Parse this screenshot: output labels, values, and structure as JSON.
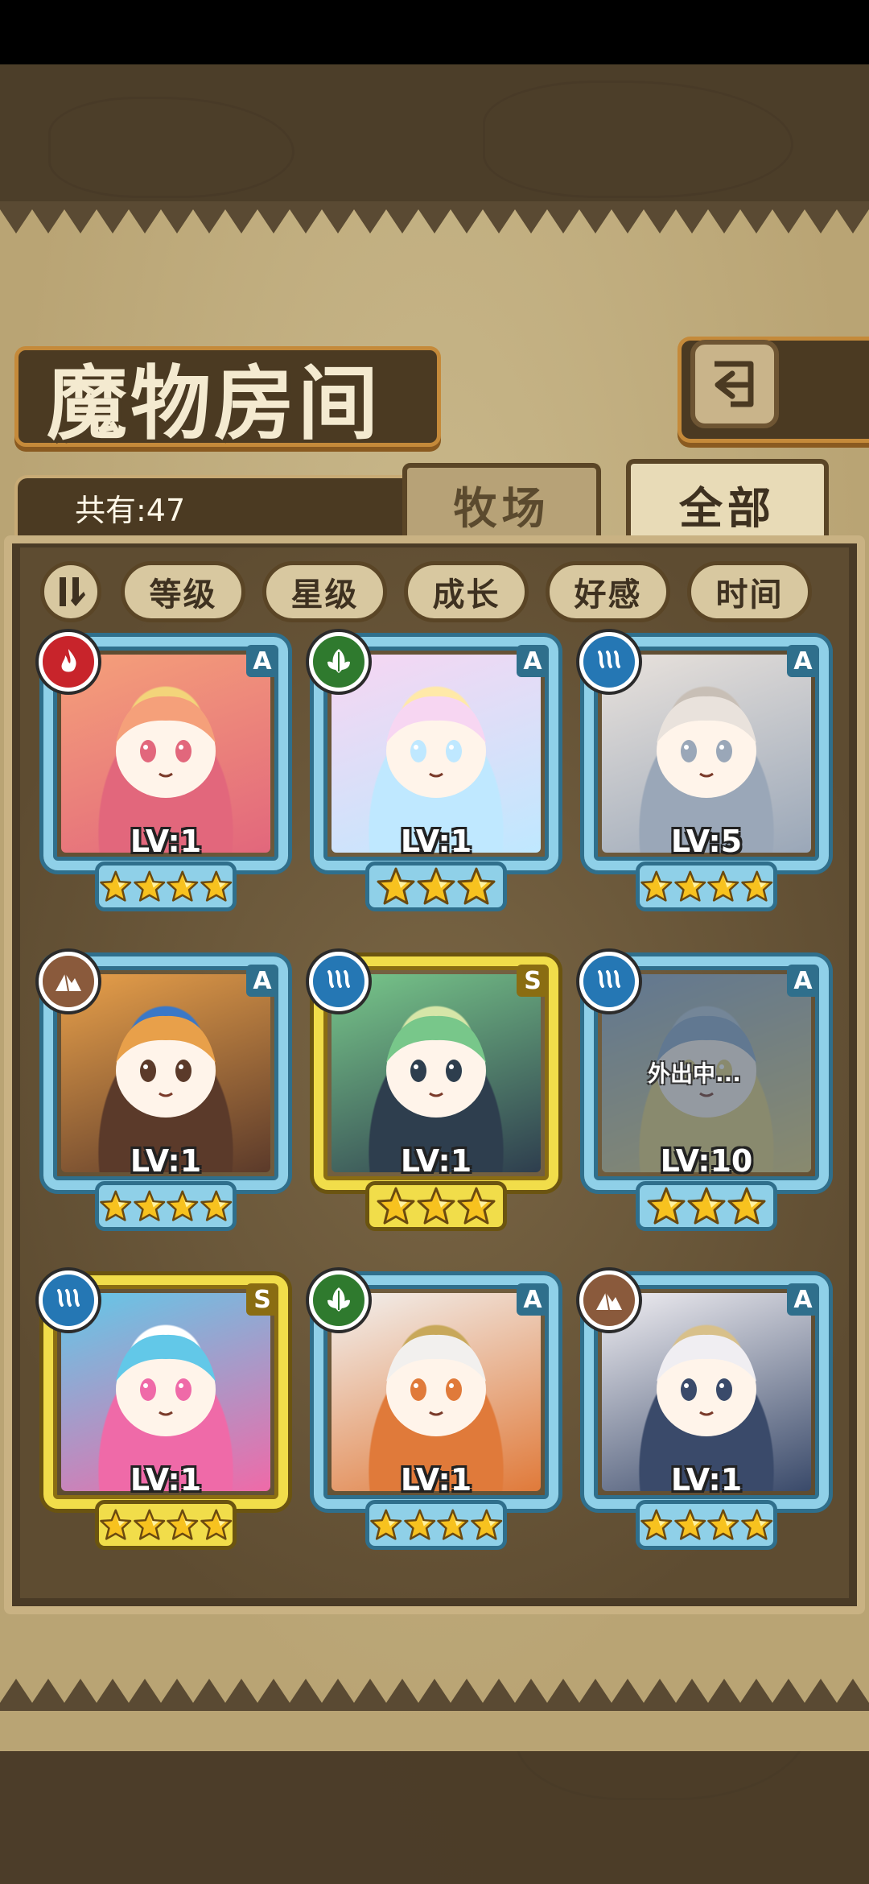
{
  "title": "魔物房间",
  "count_label": "共有:47",
  "tabs": {
    "ranch": "牧场",
    "all": "全部"
  },
  "sort_buttons": [
    "等级",
    "星级",
    "成长",
    "好感",
    "时间"
  ],
  "monsters": [
    {
      "element": "fire-icon",
      "element_color": "#c8242b",
      "rank": "A",
      "level": "LV:1",
      "stars": 4,
      "frame": "blue",
      "palette": [
        "#f5a07a",
        "#e2677c",
        "#f3d47a"
      ]
    },
    {
      "element": "leaf-icon",
      "element_color": "#2f7a2e",
      "rank": "A",
      "level": "LV:1",
      "stars": 3,
      "frame": "blue",
      "palette": [
        "#f7d6f2",
        "#bfe8ff",
        "#ffe9a8"
      ]
    },
    {
      "element": "water-icon",
      "element_color": "#2577b4",
      "rank": "A",
      "level": "LV:5",
      "stars": 4,
      "frame": "blue",
      "palette": [
        "#e9e2dc",
        "#9aa7b8",
        "#c8bfb6"
      ]
    },
    {
      "element": "earth-icon",
      "element_color": "#8a5a3c",
      "rank": "A",
      "level": "LV:1",
      "stars": 4,
      "frame": "blue",
      "palette": [
        "#e8a04a",
        "#5b3a2a",
        "#3a78c7"
      ]
    },
    {
      "element": "water-icon",
      "element_color": "#2577b4",
      "rank": "S",
      "level": "LV:1",
      "stars": 3,
      "frame": "gold",
      "palette": [
        "#78c78a",
        "#2e3e4e",
        "#d6e6a8"
      ]
    },
    {
      "element": "water-icon",
      "element_color": "#2577b4",
      "rank": "A",
      "level": "LV:10",
      "stars": 3,
      "frame": "blue",
      "palette": [
        "#8fa8c8",
        "#e6d07a",
        "#b8c8d8"
      ],
      "status": "外出中..."
    },
    {
      "element": "water-icon",
      "element_color": "#2577b4",
      "rank": "S",
      "level": "LV:1",
      "stars": 4,
      "frame": "gold",
      "palette": [
        "#62c8e8",
        "#ef6aa8",
        "#ffffff"
      ]
    },
    {
      "element": "leaf-icon",
      "element_color": "#2f7a2e",
      "rank": "A",
      "level": "LV:1",
      "stars": 4,
      "frame": "blue",
      "palette": [
        "#f2f0ee",
        "#e07a3a",
        "#c8a85a"
      ]
    },
    {
      "element": "earth-icon",
      "element_color": "#8a5a3c",
      "rank": "A",
      "level": "LV:1",
      "stars": 4,
      "frame": "blue",
      "palette": [
        "#f0eef2",
        "#3a4a6a",
        "#d8c08a"
      ]
    }
  ]
}
